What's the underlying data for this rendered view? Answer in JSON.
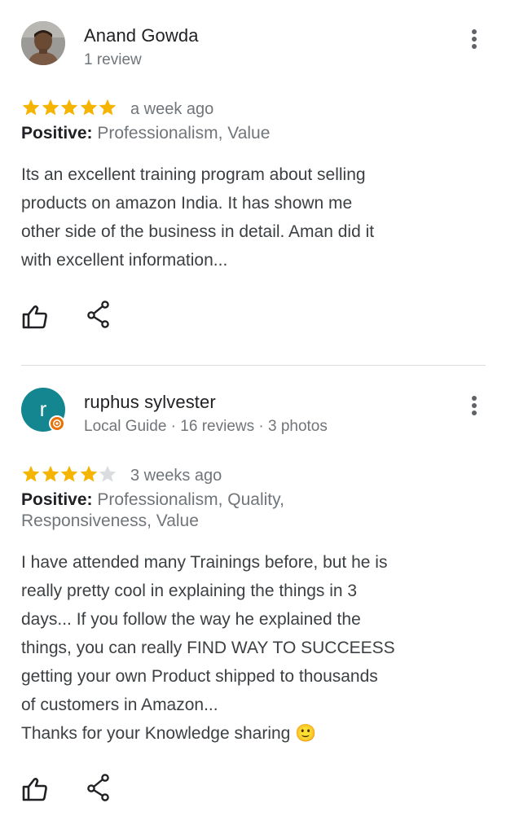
{
  "reviews": [
    {
      "author": "Anand Gowda",
      "meta": "1 review",
      "stars": 5,
      "time": "a week ago",
      "positive_label": "Positive:",
      "positive_values": "Professionalism, Value",
      "text": "Its an excellent training program about selling\nproducts on amazon India. It has shown me\nother side of the business in detail. Aman did it\nwith excellent information..."
    },
    {
      "author": "ruphus sylvester",
      "avatar_letter": "r",
      "meta": "Local Guide · 16 reviews · 3 photos",
      "stars": 4,
      "time": "3 weeks ago",
      "positive_label": "Positive:",
      "positive_values": "Professionalism, Quality,\n Responsiveness, Value",
      "text": "I have attended many Trainings before, but he is\nreally pretty cool in explaining the things in 3\ndays... If you follow the way he explained the\nthings, you can really FIND WAY TO SUCCEESS\ngetting your own Product shipped to thousands\nof customers in Amazon...\nThanks for your Knowledge sharing 🙂"
    }
  ],
  "colors": {
    "star_filled": "#f5b400",
    "star_empty": "#dadce0",
    "avatar_bg": "#13868f",
    "guide_badge": "#e8710a"
  },
  "icons": {
    "like": "thumb-up-outline-icon",
    "share": "share-icon",
    "more": "more-vert-icon"
  }
}
